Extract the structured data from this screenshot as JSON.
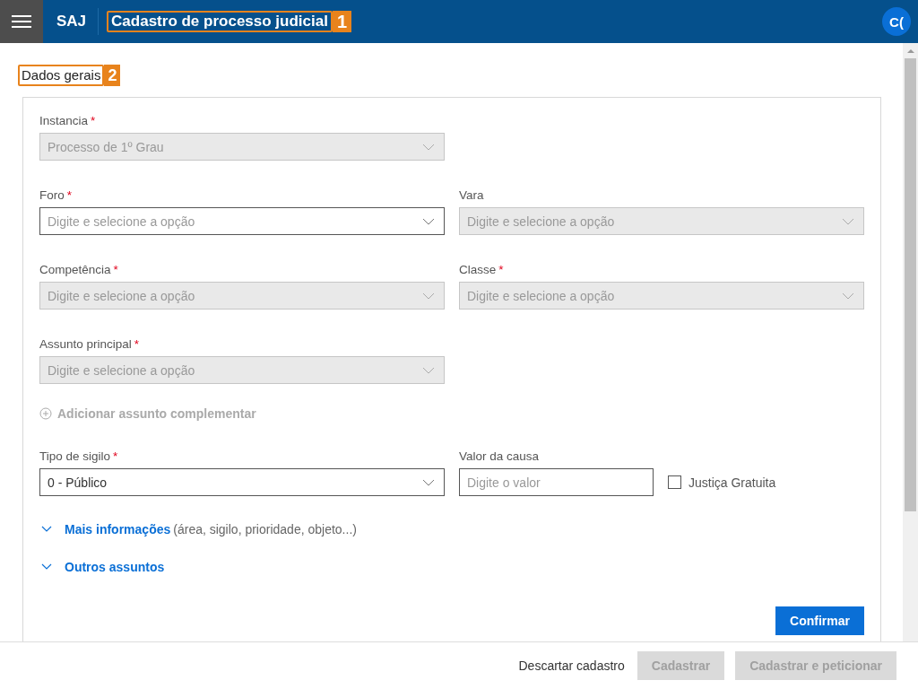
{
  "header": {
    "app_name": "SAJ",
    "title": "Cadastro de processo judicial",
    "title_callout": "1",
    "avatar": "C("
  },
  "section": {
    "title": "Dados gerais",
    "callout": "2"
  },
  "rows_top": [
    {
      "fields": [
        {
          "kind": "select",
          "label": "Instancia",
          "required_mark": "*",
          "disabled": true,
          "value": "Processo de 1º Grau"
        }
      ]
    },
    {
      "fields": [
        {
          "kind": "select",
          "label": "Foro",
          "required_mark": "*",
          "disabled": false,
          "placeholder": "Digite e selecione a opção"
        },
        {
          "kind": "select",
          "label": "Vara",
          "disabled": true,
          "placeholder": "Digite e selecione a opção"
        }
      ]
    },
    {
      "fields": [
        {
          "kind": "select",
          "label": "Competência",
          "required_mark": "*",
          "disabled": true,
          "placeholder": "Digite e selecione a opção"
        },
        {
          "kind": "select",
          "label": "Classe",
          "required_mark": "*",
          "disabled": true,
          "placeholder": "Digite e selecione a opção"
        }
      ]
    },
    {
      "fields": [
        {
          "kind": "select",
          "label": "Assunto principal",
          "required_mark": "*",
          "disabled": true,
          "placeholder": "Digite e selecione a opção"
        }
      ]
    }
  ],
  "add_link": {
    "label": "Adicionar assunto complementar",
    "disabled": true
  },
  "rows_bottom": [
    {
      "fields": [
        {
          "kind": "select",
          "label": "Tipo de sigilo",
          "required_mark": "*",
          "disabled": false,
          "value": "0 - Público"
        },
        {
          "kind": "text",
          "label": "Valor da causa",
          "disabled": false,
          "placeholder": "Digite o valor"
        },
        {
          "kind": "checkbox",
          "label": "Justiça Gratuita",
          "checked": false
        }
      ]
    }
  ],
  "expanders": [
    {
      "label": "Mais informações",
      "hint": "(área, sigilo, prioridade, objeto...)",
      "expanded": false
    },
    {
      "label": "Outros assuntos",
      "expanded": false
    }
  ],
  "confirm_button": "Confirmar",
  "footer": {
    "discard": "Descartar cadastro",
    "buttons": [
      {
        "label": "Cadastrar",
        "disabled": true
      },
      {
        "label": "Cadastrar e peticionar",
        "disabled": true
      }
    ]
  }
}
